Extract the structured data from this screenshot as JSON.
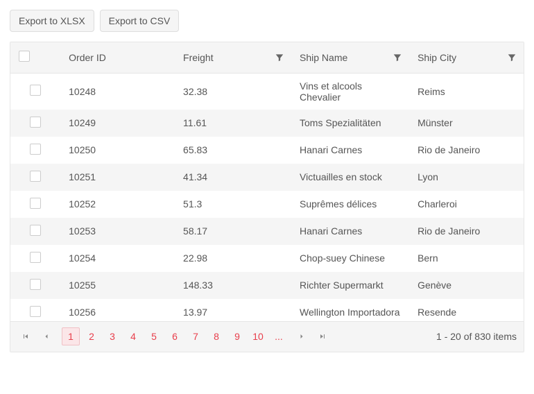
{
  "toolbar": {
    "export_xlsx": "Export to XLSX",
    "export_csv": "Export to CSV"
  },
  "grid": {
    "columns": {
      "order_id": "Order ID",
      "freight": "Freight",
      "ship_name": "Ship Name",
      "ship_city": "Ship City"
    },
    "rows": [
      {
        "order_id": "10248",
        "freight": "32.38",
        "ship_name": "Vins et alcools Chevalier",
        "ship_city": "Reims"
      },
      {
        "order_id": "10249",
        "freight": "11.61",
        "ship_name": "Toms Spezialitäten",
        "ship_city": "Münster"
      },
      {
        "order_id": "10250",
        "freight": "65.83",
        "ship_name": "Hanari Carnes",
        "ship_city": "Rio de Janeiro"
      },
      {
        "order_id": "10251",
        "freight": "41.34",
        "ship_name": "Victuailles en stock",
        "ship_city": "Lyon"
      },
      {
        "order_id": "10252",
        "freight": "51.3",
        "ship_name": "Suprêmes délices",
        "ship_city": "Charleroi"
      },
      {
        "order_id": "10253",
        "freight": "58.17",
        "ship_name": "Hanari Carnes",
        "ship_city": "Rio de Janeiro"
      },
      {
        "order_id": "10254",
        "freight": "22.98",
        "ship_name": "Chop-suey Chinese",
        "ship_city": "Bern"
      },
      {
        "order_id": "10255",
        "freight": "148.33",
        "ship_name": "Richter Supermarkt",
        "ship_city": "Genève"
      },
      {
        "order_id": "10256",
        "freight": "13.97",
        "ship_name": "Wellington Importadora",
        "ship_city": "Resende"
      }
    ]
  },
  "pager": {
    "pages": [
      "1",
      "2",
      "3",
      "4",
      "5",
      "6",
      "7",
      "8",
      "9",
      "10",
      "..."
    ],
    "current": "1",
    "info": "1 - 20 of 830 items"
  }
}
